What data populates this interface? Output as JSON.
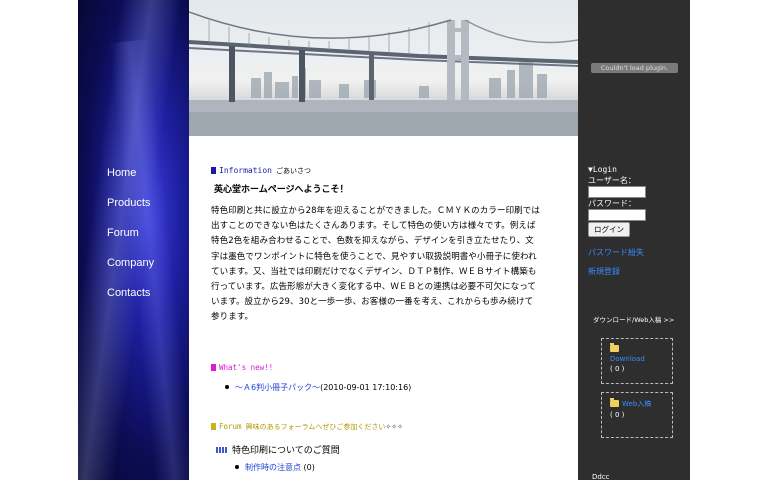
{
  "nav": {
    "items": [
      {
        "label": "Home"
      },
      {
        "label": "Products"
      },
      {
        "label": "Forum"
      },
      {
        "label": "Company"
      },
      {
        "label": "Contacts"
      }
    ]
  },
  "main": {
    "info": {
      "title": "Information",
      "subtitle": "ごあいさつ",
      "welcome": "英心堂ホームページへようこそ！",
      "body": "特色印刷と共に設立から28年を迎えることができました。ＣＭＹＫのカラー印刷では出すことのできない色はたくさんあります。そして特色の使い方は様々です。例えば特色2色を組み合わせることで、色数を抑えながら、デザインを引き立たせたり、文字は墨色でワンポイントに特色を使うことで、見やすい取扱説明書や小冊子に使われています。又、当社では印刷だけでなくデザイン、ＤＴＰ制作、ＷＥＢサイト構築も行っています。広告形態が大きく変化する中、ＷＥＢとの連携は必要不可欠になっています。設立から29、30と一歩一歩、お客様の一番を考え、これからも歩み続けて参ります。"
    },
    "whats_new": {
      "title": "What's new!!",
      "items": [
        {
          "text": "～Ａ6判小冊子パック～",
          "date": "(2010-09-01 17:10:16)"
        }
      ]
    },
    "forum": {
      "title": "Forum",
      "subtitle": "興味のあるフォーラムへぜひご参加ください",
      "topic": "特色印刷についてのご質問",
      "items": [
        {
          "text": "制作時の注意点",
          "count": "(0)"
        }
      ]
    }
  },
  "sidebar": {
    "plugin_message": "Couldn't load plugin.",
    "login": {
      "title": "▼Login",
      "username_label": "ユーザー名：",
      "password_label": "パスワード：",
      "button": "ログイン",
      "lost_password": "パスワード紛失",
      "register": "新規登録"
    },
    "downloads": {
      "heading": "ダウンロード/Web入稿 >>",
      "boxes": [
        {
          "label": "Download",
          "count": "( 0 )"
        },
        {
          "label": "Web入稿",
          "count": "( 0 )"
        }
      ]
    },
    "cut_text": "Ddcc"
  },
  "colors": {
    "info_accent": "#1a1aa6",
    "whats_new_accent": "#d81bd8",
    "forum_accent": "#b29a00",
    "sidebar_bg": "#2e2e2e",
    "link": "#3b8bff"
  }
}
